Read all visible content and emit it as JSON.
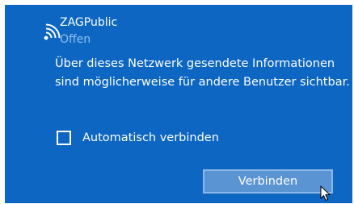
{
  "network": {
    "name": "ZAGPublic",
    "status": "Offen",
    "icon": "wifi-signal-icon"
  },
  "info": {
    "text": "Über dieses Netzwerk gesendete Informationen sind möglicherweise für andere Benutzer sichtbar."
  },
  "auto_connect": {
    "label": "Automatisch verbinden",
    "checked": false
  },
  "connect_button": {
    "label": "Verbinden"
  },
  "colors": {
    "panel_bg": "#0c66c2",
    "status_text": "#8fc1f0",
    "button_bg": "#5a94d2",
    "button_border": "#8db8e6"
  }
}
